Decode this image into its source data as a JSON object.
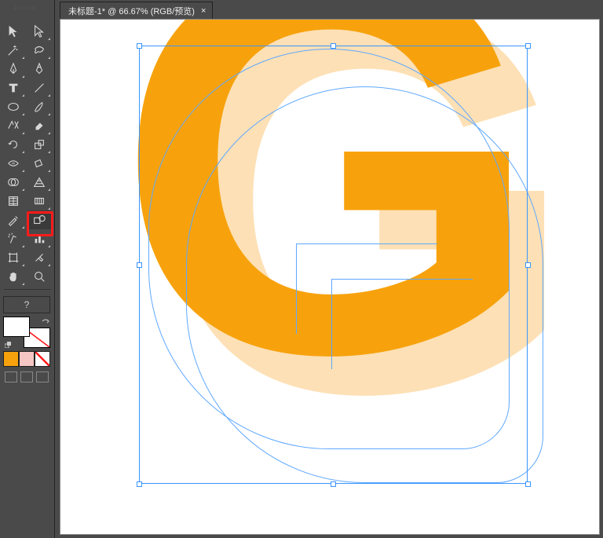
{
  "tab": {
    "title": "未标题-1* @ 66.67% (RGB/预览)",
    "close": "×"
  },
  "toolbar": {
    "help": "?",
    "tools": [
      "selection",
      "direct-select",
      "magic-wand",
      "lasso",
      "pen",
      "curvature",
      "type",
      "line",
      "rectangle",
      "paintbrush",
      "shaper",
      "eraser",
      "rotate",
      "scale",
      "width",
      "free-transform",
      "shape-builder",
      "perspective",
      "mesh",
      "gradient",
      "eyedropper",
      "blend",
      "symbol-sprayer",
      "column-graph",
      "artboard",
      "slice",
      "hand",
      "zoom"
    ]
  },
  "highlight_tool": "blend",
  "canvas": {
    "letter": "G",
    "fill_color": "#f7a20d",
    "shadow_color": "#fde0b5"
  },
  "swatches": {
    "active": "#f7a20d",
    "secondary": "#f5c6c3"
  }
}
